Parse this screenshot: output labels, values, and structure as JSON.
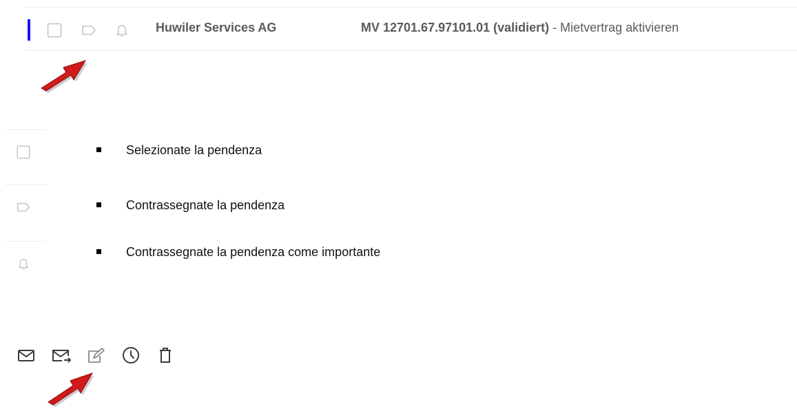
{
  "task_row": {
    "sender": "Huwiler Services AG",
    "subject_strong": "MV 12701.67.97101.01 (validiert)",
    "subject_rest": " - Mietvertrag aktivieren",
    "accent_color": "#1a0dff",
    "icons": [
      "checkbox-icon",
      "tag-icon",
      "bell-icon"
    ]
  },
  "legend": [
    {
      "icon": "checkbox-icon",
      "text": "Selezionate la pendenza"
    },
    {
      "icon": "tag-icon",
      "text": "Contrassegnate la pendenza"
    },
    {
      "icon": "bell-icon",
      "text": "Contrassegnate la pendenza come importante"
    }
  ],
  "toolbar": {
    "icons": [
      "mail-icon",
      "mail-forward-icon",
      "edit-icon",
      "clock-icon",
      "trash-icon"
    ]
  },
  "annotation_color": "#d11a1a"
}
